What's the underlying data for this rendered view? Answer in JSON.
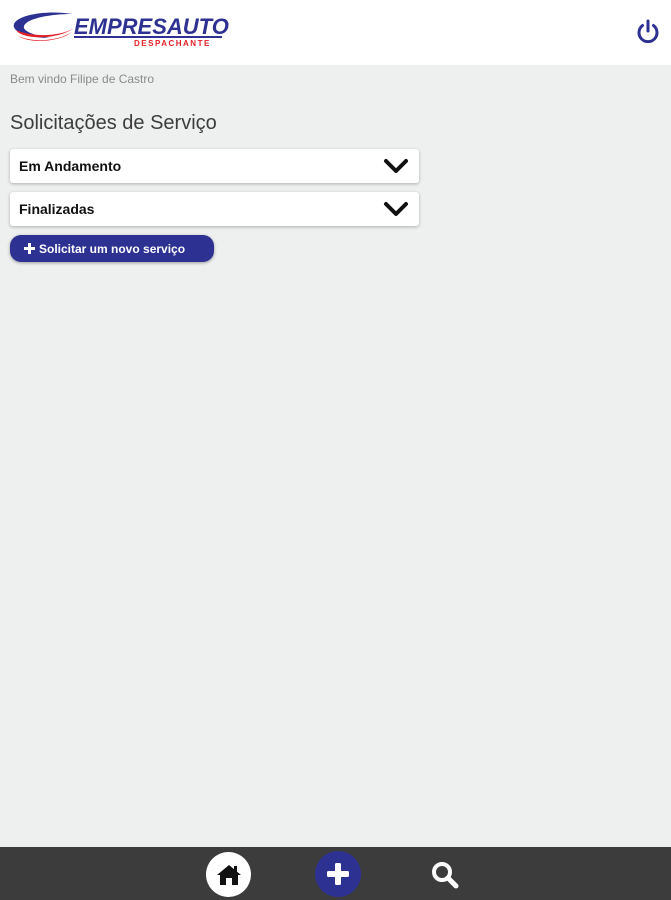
{
  "header": {
    "logo_text": "EMPRESAUTO",
    "logo_subtext": "DESPACHANTE",
    "power_icon": "power-icon"
  },
  "welcome_text": "Bem vindo Filipe de Castro",
  "page_title": "Solicitações de Serviço",
  "accordions": [
    {
      "label": "Em Andamento",
      "icon": "chevron-down-icon"
    },
    {
      "label": "Finalizadas",
      "icon": "chevron-down-icon"
    }
  ],
  "new_service_button": {
    "label": "Solicitar um novo serviço",
    "icon": "plus-icon"
  },
  "bottom_nav": [
    {
      "name": "home",
      "icon": "home-icon"
    },
    {
      "name": "add",
      "icon": "plus-icon"
    },
    {
      "name": "search",
      "icon": "search-icon"
    }
  ],
  "colors": {
    "primary": "#2d3192",
    "logo_red": "#e21f26",
    "background": "#eeefef",
    "bottom_bar": "#3c3c3c"
  }
}
